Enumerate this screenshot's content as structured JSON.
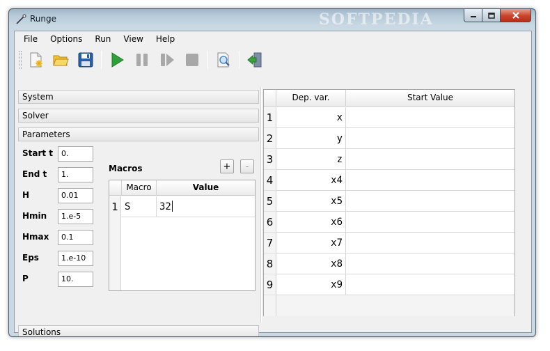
{
  "window": {
    "title": "Runge",
    "watermark": "SOFTPEDIA"
  },
  "menu": [
    "File",
    "Options",
    "Run",
    "View",
    "Help"
  ],
  "toolbar": {
    "buttons": [
      {
        "name": "new-icon",
        "color": "#f2f2f2"
      },
      {
        "name": "open-folder-icon",
        "color": "#f2c232"
      },
      {
        "name": "save-icon",
        "color": "#2a5fa8"
      },
      {
        "name": "run-icon",
        "color": "#2ea03a"
      },
      {
        "name": "pause-icon",
        "color": "#a8a8a8"
      },
      {
        "name": "step-icon",
        "color": "#a8a8a8"
      },
      {
        "name": "stop-icon",
        "color": "#a8a8a8"
      },
      {
        "name": "preview-icon",
        "color": "#4a8ad0"
      },
      {
        "name": "exit-icon",
        "color": "#3aa040"
      }
    ]
  },
  "sections": {
    "system": "System",
    "solver": "Solver",
    "parameters": "Parameters",
    "solutions": "Solutions"
  },
  "parameters": [
    {
      "label": "Start t",
      "value": "0."
    },
    {
      "label": "End t",
      "value": "1."
    },
    {
      "label": "H",
      "value": "0.01"
    },
    {
      "label": "Hmin",
      "value": "1.e-5"
    },
    {
      "label": "Hmax",
      "value": "0.1"
    },
    {
      "label": "Eps",
      "value": "1.e-10"
    },
    {
      "label": "P",
      "value": "10."
    }
  ],
  "macros": {
    "title": "Macros",
    "add_label": "+",
    "remove_label": "-",
    "columns": [
      "Macro",
      "Value"
    ],
    "rows": [
      {
        "num": "1",
        "macro": "S",
        "value": "32"
      }
    ]
  },
  "dep_table": {
    "columns": [
      "Dep. var.",
      "Start Value"
    ],
    "rows": [
      {
        "num": "1",
        "var": "x",
        "value": ""
      },
      {
        "num": "2",
        "var": "y",
        "value": ""
      },
      {
        "num": "3",
        "var": "z",
        "value": ""
      },
      {
        "num": "4",
        "var": "x4",
        "value": ""
      },
      {
        "num": "5",
        "var": "x5",
        "value": ""
      },
      {
        "num": "6",
        "var": "x6",
        "value": ""
      },
      {
        "num": "7",
        "var": "x7",
        "value": ""
      },
      {
        "num": "8",
        "var": "x8",
        "value": ""
      },
      {
        "num": "9",
        "var": "x9",
        "value": ""
      }
    ]
  }
}
